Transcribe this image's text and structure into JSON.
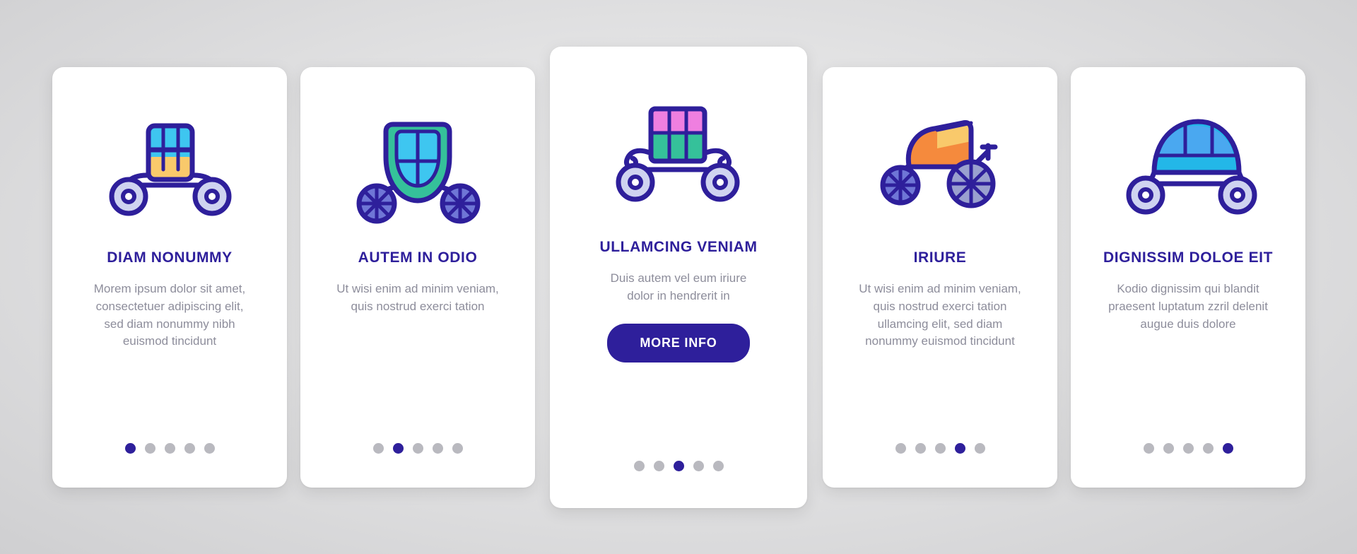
{
  "theme": {
    "accent": "#2e1f9b",
    "muted_text": "#8d8d9b",
    "dot_inactive": "#b9b9bf",
    "card_bg": "#ffffff",
    "page_bg": "#dedede"
  },
  "cards": [
    {
      "icon": "carriage-icon",
      "title": "DIAM NONUMMY",
      "description": "Morem ipsum dolor sit amet, consectetuer adipiscing elit, sed diam nonummy nibh euismod tincidunt",
      "dots": {
        "count": 5,
        "active": 0
      },
      "button": null
    },
    {
      "icon": "carriage-cabin-icon",
      "title": "AUTEM IN ODIO",
      "description": "Ut wisi enim ad minim veniam, quis nostrud exerci tation",
      "dots": {
        "count": 5,
        "active": 1
      },
      "button": null
    },
    {
      "icon": "carriage-open-icon",
      "title": "ULLAMCING VENIAM",
      "description": "Duis autem vel eum iriure dolor in hendrerit in",
      "dots": {
        "count": 5,
        "active": 2
      },
      "button": "MORE INFO"
    },
    {
      "icon": "rickshaw-icon",
      "title": "IRIURE",
      "description": "Ut wisi enim ad minim veniam, quis nostrud exerci tation ullamcing elit, sed diam nonummy euismod tincidunt",
      "dots": {
        "count": 5,
        "active": 3
      },
      "button": null
    },
    {
      "icon": "carriage-round-icon",
      "title": "DIGNISSIM DOLOE EIT",
      "description": "Kodio dignissim qui blandit praesent luptatum zzril delenit augue duis dolore",
      "dots": {
        "count": 5,
        "active": 4
      },
      "button": null
    }
  ]
}
